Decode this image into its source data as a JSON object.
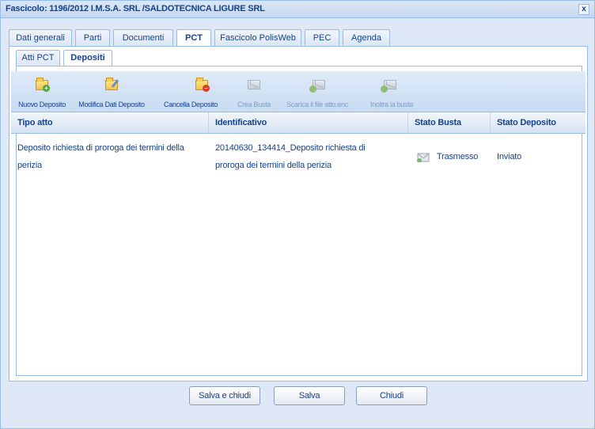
{
  "window": {
    "title": "Fascicolo: 1196/2012 I.M.S.A. SRL /SALDOTECNICA LIGURE SRL",
    "close_glyph": "x"
  },
  "main_tabs": [
    {
      "label": "Dati generali",
      "active": false
    },
    {
      "label": "Parti",
      "active": false
    },
    {
      "label": "Documenti",
      "active": false
    },
    {
      "label": "PCT",
      "active": true
    },
    {
      "label": "Fascicolo PolisWeb",
      "active": false
    },
    {
      "label": "PEC",
      "active": false
    },
    {
      "label": "Agenda",
      "active": false
    }
  ],
  "sub_tabs": [
    {
      "label": "Atti PCT",
      "active": false
    },
    {
      "label": "Depositi",
      "active": true
    }
  ],
  "toolbar": [
    {
      "label": "Nuovo Deposito",
      "icon": "folder-add-icon",
      "enabled": true
    },
    {
      "label": "Modifica Dati Deposito",
      "icon": "folder-edit-icon",
      "enabled": true
    },
    {
      "label": "Cancella Deposito",
      "icon": "folder-delete-icon",
      "enabled": true
    },
    {
      "label": "Crea Busta",
      "icon": "envelope-icon",
      "enabled": false
    },
    {
      "label": "Scarica il file atto.enc",
      "icon": "envelope-download-icon",
      "enabled": false
    },
    {
      "label": "Inoltra la busta",
      "icon": "envelope-forward-icon",
      "enabled": false
    }
  ],
  "grid": {
    "columns": [
      "Tipo atto",
      "Identificativo",
      "Stato Busta",
      "Stato Deposito"
    ],
    "rows": [
      {
        "tipo_atto_line1": "Deposito richiesta di proroga dei termini della",
        "tipo_atto_line2": "perizia",
        "identificativo_line1": "20140630_134414_Deposito richiesta di",
        "identificativo_line2": "proroga dei termini della perizia",
        "stato_busta": "Trasmesso",
        "stato_busta_icon": "envelope-sent-icon",
        "stato_deposito": "Inviato"
      }
    ]
  },
  "footer": {
    "save_close": "Salva e chiudi",
    "save": "Salva",
    "close": "Chiudi"
  },
  "colors": {
    "text": "#15428b",
    "border": "#99bbe8",
    "window_bg": "#dfe8f6"
  }
}
